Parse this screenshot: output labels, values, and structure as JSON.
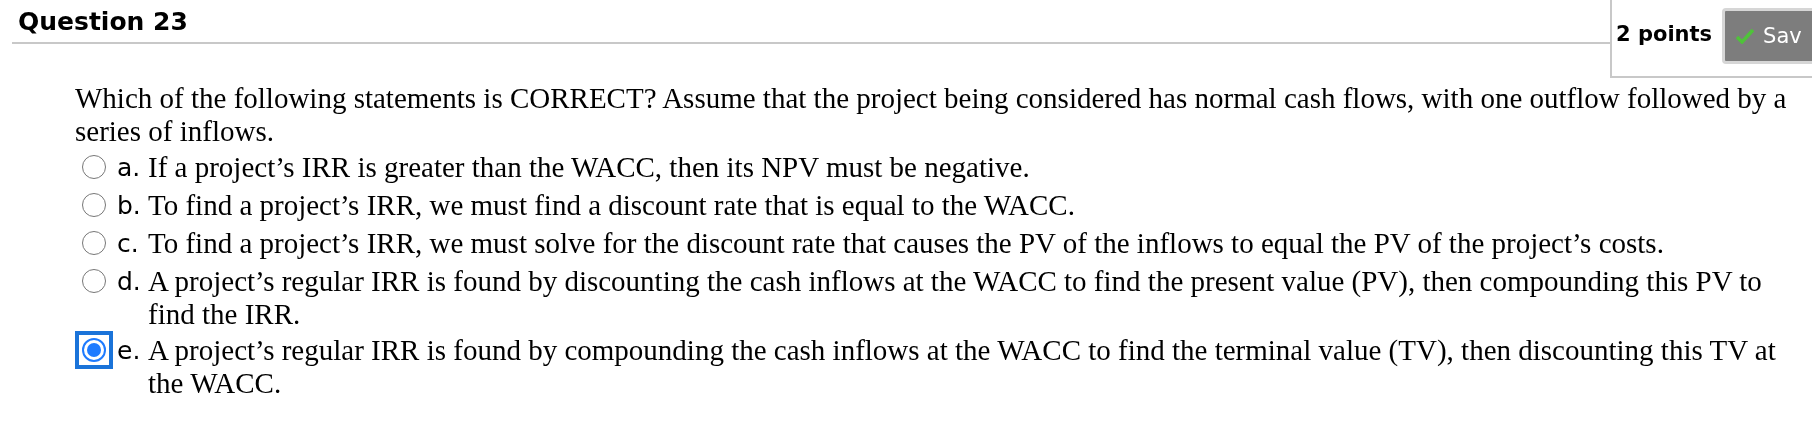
{
  "question": {
    "title": "Question 23",
    "points": "2 points",
    "save_button": "Sav",
    "prompt": "Which of the following statements is CORRECT? Assume that the project being considered has normal cash flows, with one outflow followed by a series of inflows.",
    "options": [
      {
        "letter": "a.",
        "text": "If a project’s IRR is greater than the WACC, then its NPV must be negative.",
        "selected": false
      },
      {
        "letter": "b.",
        "text": "To find a project’s IRR, we must find a discount rate that is equal to the WACC.",
        "selected": false
      },
      {
        "letter": "c.",
        "text": "To find a project’s IRR, we must solve for the discount rate that causes the PV of the inflows to equal the PV of the project’s costs.",
        "selected": false
      },
      {
        "letter": "d.",
        "text": "A project’s regular IRR is found by discounting the cash inflows at the WACC to find the present value (PV), then compounding this PV to find the IRR.",
        "selected": false
      },
      {
        "letter": "e.",
        "text": "A project’s regular IRR is found by compounding the cash inflows at the WACC to find the terminal value (TV), then discounting this TV at the WACC.",
        "selected": true
      }
    ]
  }
}
